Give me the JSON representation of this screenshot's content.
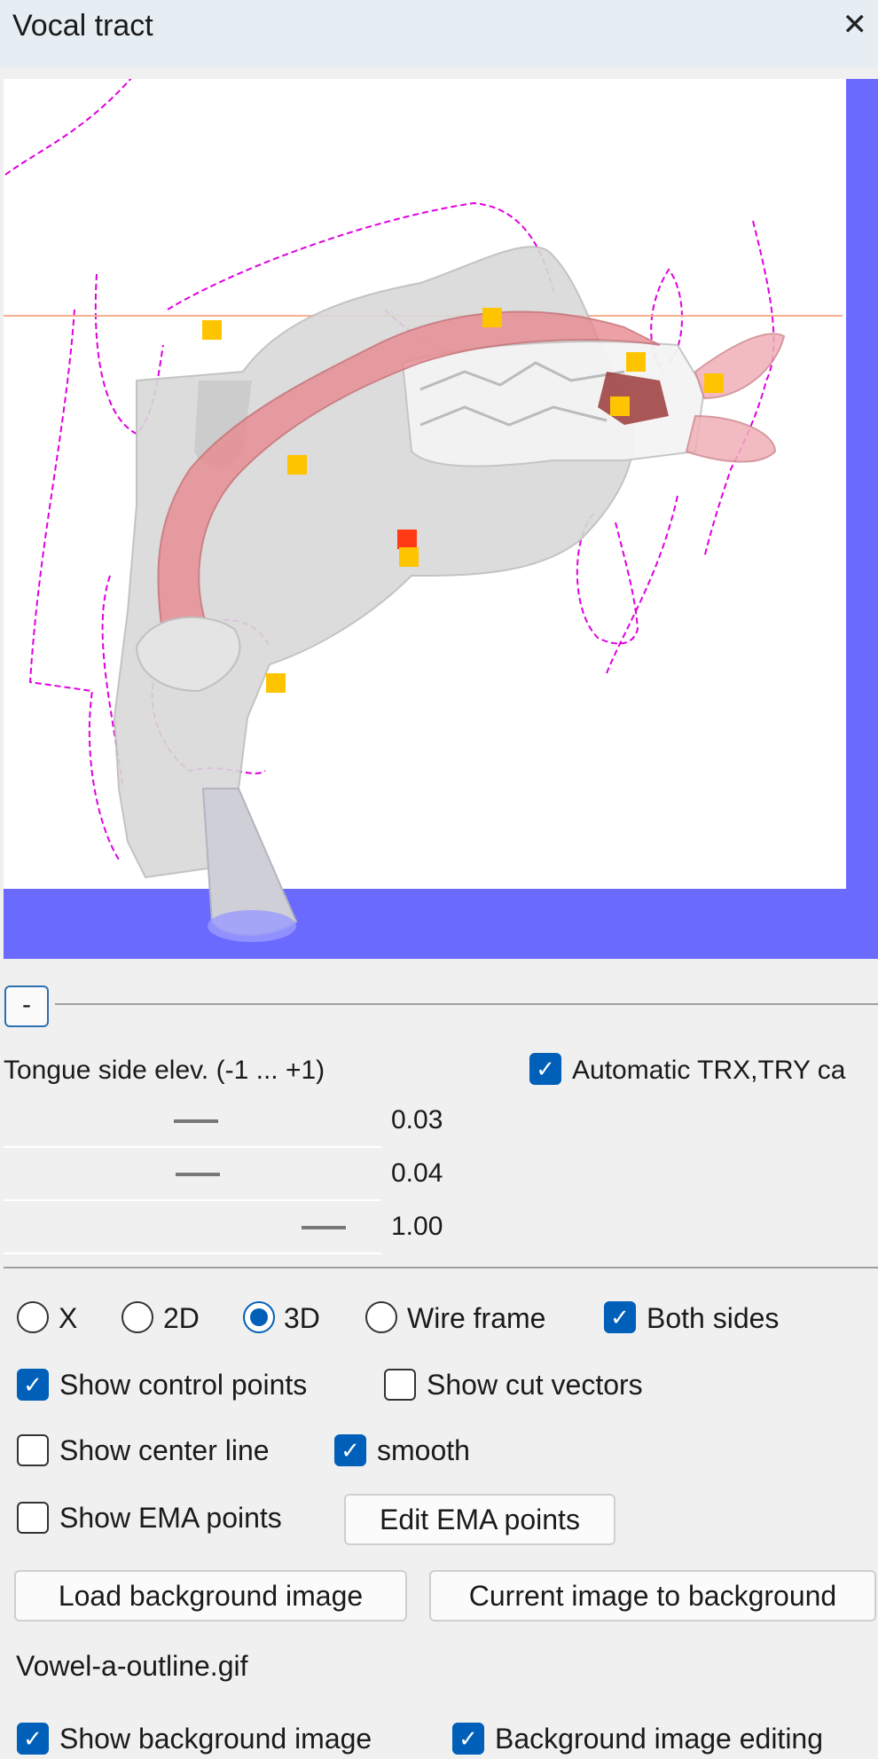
{
  "window": {
    "title": "Vocal tract",
    "close_icon": "close-icon"
  },
  "view": {
    "background_color": "#6a6aff"
  },
  "collapse_button": {
    "label": "-"
  },
  "parameter": {
    "label": "Tongue side elev. (-1 ... +1)",
    "rows": [
      {
        "value": "0.03",
        "slider_level": 0.515
      },
      {
        "value": "0.04",
        "slider_level": 0.52
      },
      {
        "value": "1.00",
        "slider_level": 1.0
      }
    ]
  },
  "auto_trx": {
    "label": "Automatic TRX,TRY ca",
    "checked": true
  },
  "view_mode": {
    "options": [
      {
        "label": "X",
        "selected": false
      },
      {
        "label": "2D",
        "selected": false
      },
      {
        "label": "3D",
        "selected": true
      },
      {
        "label": "Wire frame",
        "selected": false
      }
    ]
  },
  "options": {
    "both_sides": {
      "label": "Both sides",
      "checked": true
    },
    "show_control_points": {
      "label": "Show control points",
      "checked": true
    },
    "show_cut_vectors": {
      "label": "Show cut vectors",
      "checked": false
    },
    "show_center_line": {
      "label": "Show center line",
      "checked": false
    },
    "smooth": {
      "label": "smooth",
      "checked": true
    },
    "show_ema_points": {
      "label": "Show EMA points",
      "checked": false
    },
    "show_background_image": {
      "label": "Show background image",
      "checked": true
    },
    "background_image_editing": {
      "label": "Background image editing",
      "checked": true
    }
  },
  "buttons": {
    "edit_ema_points": "Edit EMA points",
    "load_background_image": "Load background image",
    "current_image_to_background": "Current image to background"
  },
  "background_file": "Vowel-a-outline.gif",
  "check_glyph": "✓"
}
